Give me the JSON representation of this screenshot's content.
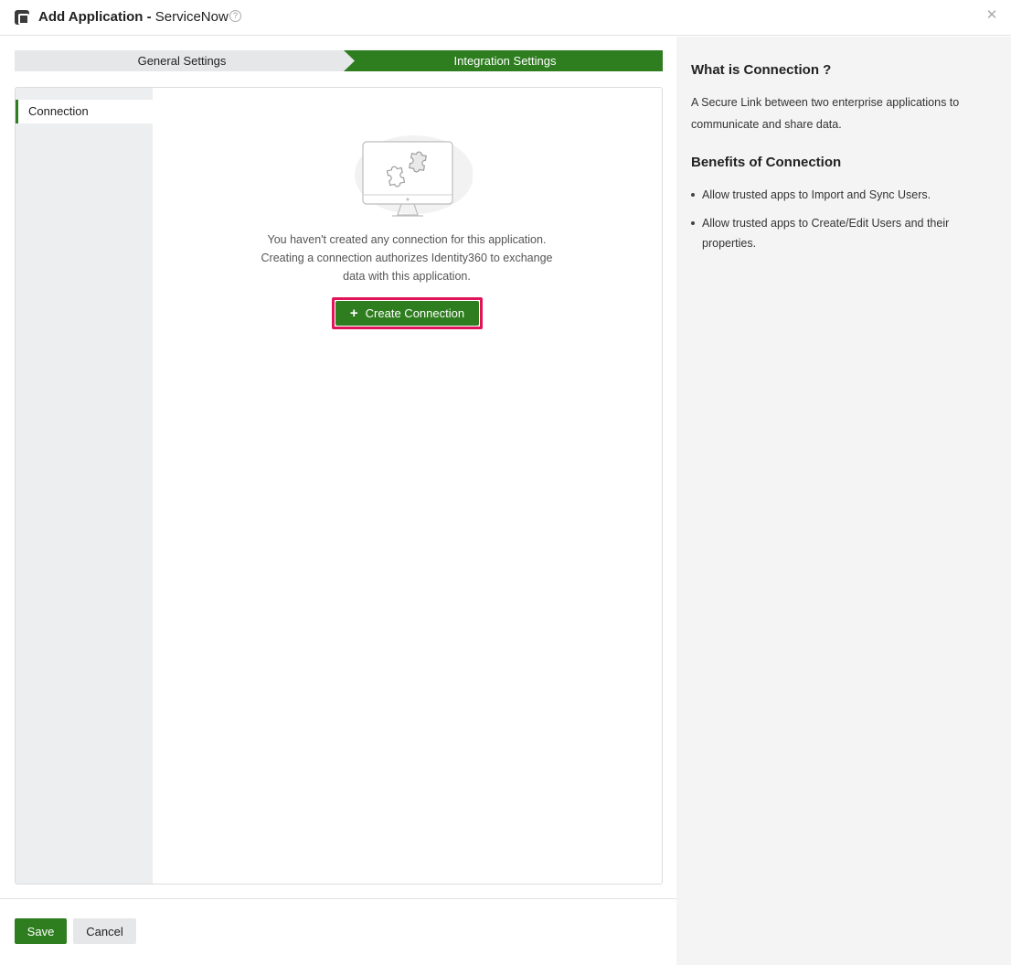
{
  "header": {
    "title_bold": "Add Application",
    "separator": " - ",
    "app_name": "ServiceNow",
    "help_icon": "question-circle-icon",
    "close_icon": "close-icon"
  },
  "stepper": {
    "steps": [
      {
        "label": "General Settings",
        "state": "completed"
      },
      {
        "label": "Integration Settings",
        "state": "active"
      }
    ],
    "active_color": "#2e7d1f",
    "inactive_color": "#e6e7e8"
  },
  "sidebar": {
    "items": [
      {
        "label": "Connection",
        "selected": true
      }
    ]
  },
  "empty_state": {
    "illustration": "monitor-puzzle-illustration",
    "lines": [
      "You haven't created any connection for this application.",
      "Creating a connection authorizes Identity360 to exchange",
      "data with this application."
    ],
    "cta_label": "Create Connection",
    "cta_icon": "plus-icon",
    "highlight_color": "#e0145a"
  },
  "footer": {
    "save_label": "Save",
    "cancel_label": "Cancel"
  },
  "info": {
    "heading1": "What is Connection ?",
    "paragraph": "A Secure Link between two enterprise applications to communicate and share data.",
    "heading2": "Benefits of Connection",
    "benefits": [
      "Allow trusted apps to Import and Sync Users.",
      "Allow trusted apps to Create/Edit Users and their properties."
    ]
  }
}
